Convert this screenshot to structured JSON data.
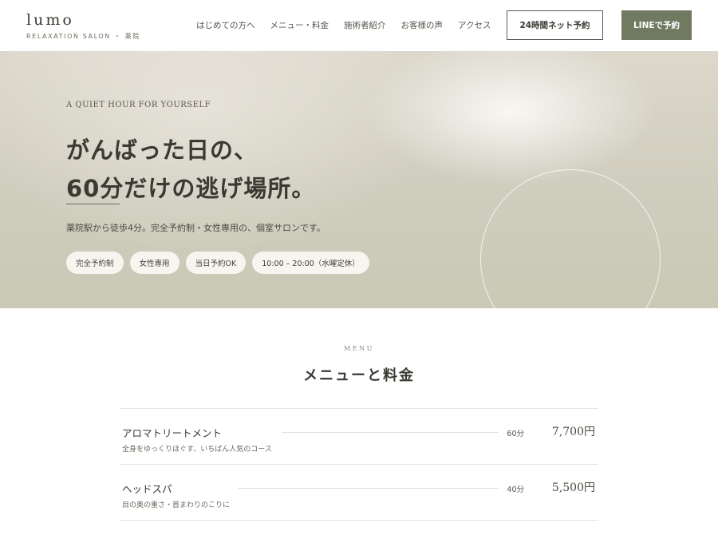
{
  "brand": {
    "name": "lumo",
    "sub": "RELAXATION SALON ・ 薬院"
  },
  "nav": [
    {
      "label": "はじめての方へ"
    },
    {
      "label": "メニュー・料金"
    },
    {
      "label": "施術者紹介"
    },
    {
      "label": "お客様の声"
    },
    {
      "label": "アクセス"
    }
  ],
  "buttons": {
    "web_booking": "24時間ネット予約",
    "line_booking": "LINEで予約"
  },
  "hero": {
    "eyebrow": "A QUIET HOUR FOR YOURSELF",
    "headline_1": "がんばった日の、",
    "headline_2": "60分だけの逃げ場所。",
    "description": "薬院駅から徒歩4分。完全予約制・女性専用の、個室サロンです。",
    "tags": [
      "完全予約制",
      "女性専用",
      "当日予約OK",
      "10:00 – 20:00（水曜定休）"
    ]
  },
  "menu": {
    "eyebrow": "MENU",
    "title": "メニューと料金",
    "items": [
      {
        "name": "アロマトリートメント",
        "desc": "全身をゆっくりほぐす、いちばん人気のコース",
        "duration": "60分",
        "price": "7,700円"
      },
      {
        "name": "ヘッドスパ",
        "desc": "目の奥の重さ・首まわりのこりに",
        "duration": "40分",
        "price": "5,500円"
      }
    ]
  },
  "colors": {
    "accent": "#6f7a60",
    "hero_bg": "#cfcdbe",
    "text": "#3a3a33"
  }
}
